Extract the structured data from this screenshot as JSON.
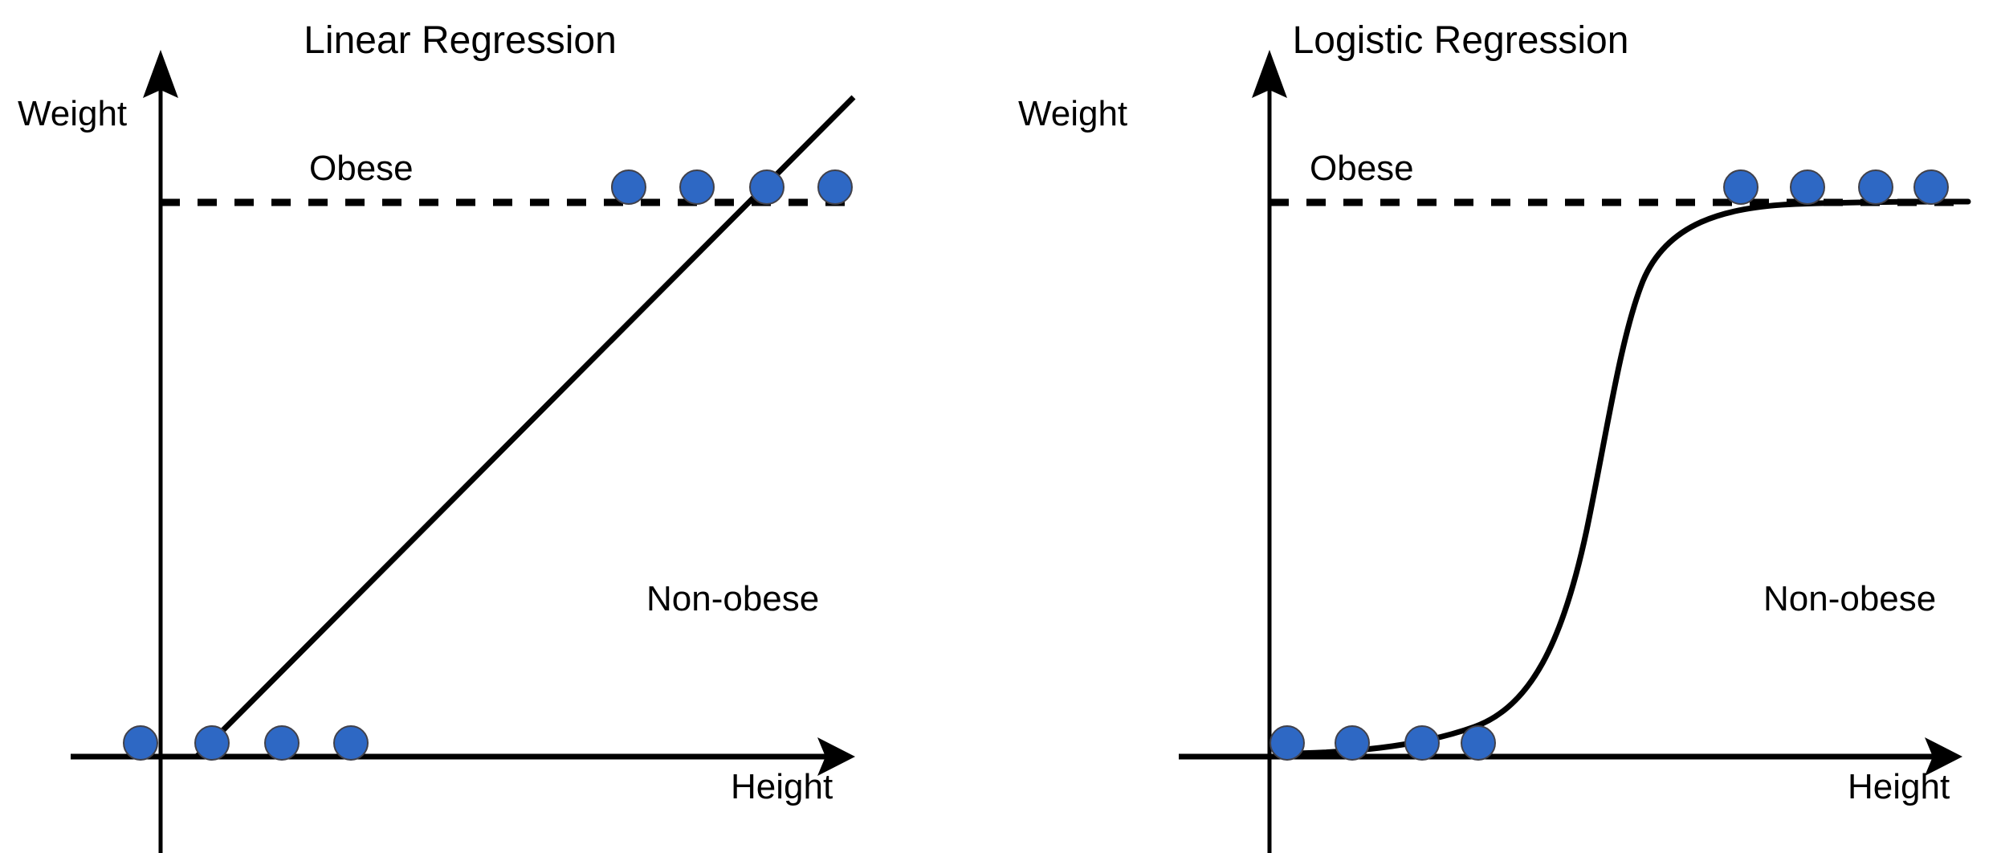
{
  "figure": {
    "background_color": "#ffffff",
    "stroke_color": "#000000",
    "point_fill_color": "#2E68C4",
    "point_stroke_color": "#41414a"
  },
  "panels": [
    {
      "id": "linear",
      "title": "Linear Regression",
      "y_axis_label": "Weight",
      "x_axis_label": "Height",
      "upper_region_label": "Obese",
      "lower_region_label": "Non-obese"
    },
    {
      "id": "logistic",
      "title": "Logistic Regression",
      "y_axis_label": "Weight",
      "x_axis_label": "Height",
      "upper_region_label": "Obese",
      "lower_region_label": "Non-obese"
    }
  ],
  "chart_data": [
    {
      "type": "scatter",
      "id": "linear-regression-plot",
      "title": "Linear Regression",
      "xlabel": "Height",
      "ylabel": "Weight",
      "grid": false,
      "legend": false,
      "annotations": [
        {
          "text": "Obese",
          "x": 0.28,
          "y": 0.82
        },
        {
          "text": "Non-obese",
          "x": 0.72,
          "y": 0.24
        }
      ],
      "threshold_line": {
        "style": "dashed",
        "label": "Obese",
        "y": 1.0,
        "description": "horizontal dashed line separating obese (above) from non-obese (below)"
      },
      "series": [
        {
          "name": "Non-obese samples",
          "class_value": 0,
          "x": [
            0.0,
            0.055,
            0.13,
            0.22
          ],
          "y": [
            0,
            0,
            0,
            0
          ]
        },
        {
          "name": "Obese samples",
          "class_value": 1,
          "x": [
            0.675,
            0.775,
            0.875,
            0.975
          ],
          "y": [
            1,
            1,
            1,
            1
          ]
        }
      ],
      "fit": {
        "name": "Least squares line",
        "type": "line",
        "style": "solid",
        "x_start": 0.05,
        "y_start": 0.0,
        "x_end": 1.0,
        "y_end": 1.19,
        "description": "straight line extending above the obese threshold"
      },
      "xlim": [
        0,
        1.0
      ],
      "ylim": [
        0,
        1.25
      ]
    },
    {
      "type": "scatter",
      "id": "logistic-regression-plot",
      "title": "Logistic Regression",
      "xlabel": "Height",
      "ylabel": "Weight",
      "grid": false,
      "legend": false,
      "annotations": [
        {
          "text": "Obese",
          "x": 0.28,
          "y": 0.82
        },
        {
          "text": "Non-obese",
          "x": 0.72,
          "y": 0.24
        }
      ],
      "threshold_line": {
        "style": "dashed",
        "label": "Obese",
        "y": 1.0,
        "description": "horizontal dashed line separating obese (above) from non-obese (below)"
      },
      "series": [
        {
          "name": "Non-obese samples",
          "class_value": 0,
          "x": [
            0.025,
            0.12,
            0.22,
            0.3
          ],
          "y": [
            0,
            0,
            0,
            0
          ]
        },
        {
          "name": "Obese samples",
          "class_value": 1,
          "x": [
            0.68,
            0.78,
            0.88,
            0.96
          ],
          "y": [
            1,
            1,
            1,
            1
          ]
        }
      ],
      "fit": {
        "name": "Sigmoid curve",
        "type": "logistic",
        "style": "solid",
        "inflection_x": 0.52,
        "inflection_y": 0.5,
        "asymptote_low": 0.0,
        "asymptote_high": 1.0,
        "description": "S-shaped curve saturating at the obese threshold"
      },
      "xlim": [
        0,
        1.0
      ],
      "ylim": [
        0,
        1.25
      ]
    }
  ]
}
